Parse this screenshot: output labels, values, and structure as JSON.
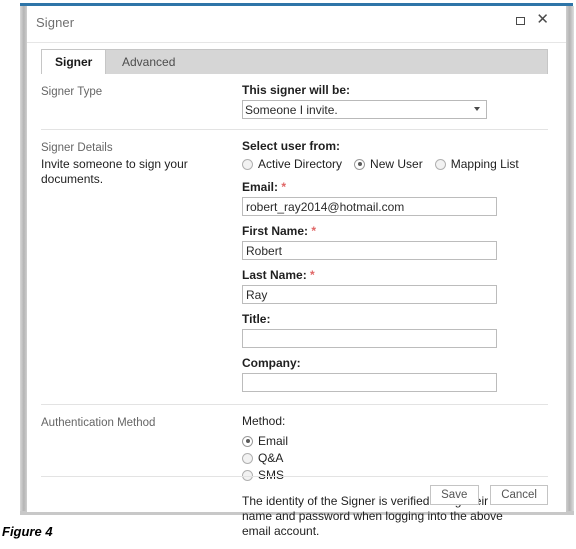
{
  "window": {
    "title": "Signer",
    "restore_icon": "restore-window-icon",
    "close_icon": "close-icon"
  },
  "tabs": [
    {
      "label": "Signer",
      "active": true
    },
    {
      "label": "Advanced",
      "active": false
    }
  ],
  "sections": {
    "signer_type": {
      "left_title": "Signer Type",
      "field_label": "This signer will be:",
      "select_value": "Someone I invite.",
      "select_options": [
        "Someone I invite."
      ]
    },
    "signer_details": {
      "left_title": "Signer Details",
      "left_desc": "Invite someone to sign your documents.",
      "user_source_label": "Select user from:",
      "user_source_options": [
        {
          "label": "Active Directory",
          "selected": false
        },
        {
          "label": "New User",
          "selected": true
        },
        {
          "label": "Mapping List",
          "selected": false
        }
      ],
      "fields": [
        {
          "label": "Email:",
          "required": true,
          "value": "robert_ray2014@hotmail.com",
          "placeholder": ""
        },
        {
          "label": "First Name:",
          "required": true,
          "value": "Robert",
          "placeholder": ""
        },
        {
          "label": "Last Name:",
          "required": true,
          "value": "Ray",
          "placeholder": ""
        },
        {
          "label": "Title:",
          "required": false,
          "value": "",
          "placeholder": ""
        },
        {
          "label": "Company:",
          "required": false,
          "value": "",
          "placeholder": ""
        }
      ],
      "required_marker": "*"
    },
    "authentication": {
      "left_title": "Authentication Method",
      "method_label": "Method:",
      "methods": [
        {
          "label": "Email",
          "selected": true
        },
        {
          "label": "Q&A",
          "selected": false
        },
        {
          "label": "SMS",
          "selected": false
        }
      ],
      "help_text": "The identity of the Signer is verified using their secure name and password when logging into the above email account."
    }
  },
  "footer": {
    "save_label": "Save",
    "cancel_label": "Cancel"
  },
  "caption": "Figure 4",
  "colors": {
    "accent_blue": "#2e75a8",
    "required_red": "#e06666",
    "tab_strip_gray": "#d6d6d6"
  }
}
